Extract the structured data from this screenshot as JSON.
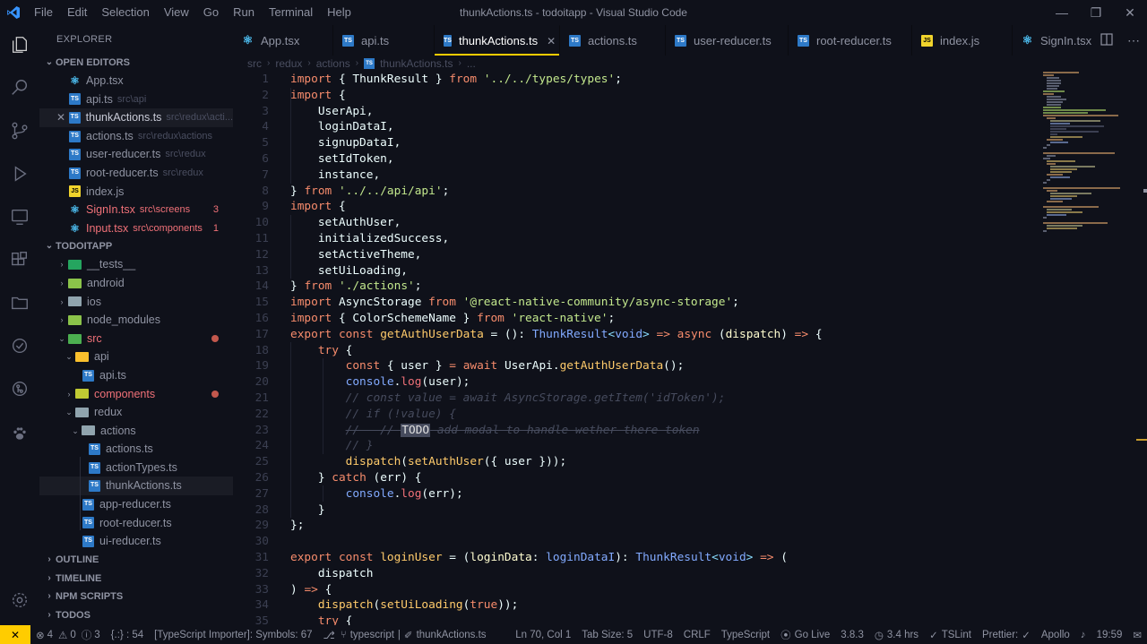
{
  "window": {
    "title": "thunkActions.ts - todoitapp - Visual Studio Code",
    "menu": [
      "File",
      "Edit",
      "Selection",
      "View",
      "Go",
      "Run",
      "Terminal",
      "Help"
    ]
  },
  "colors": {
    "accent": "#ffcc00",
    "background": "#0f111a",
    "error": "#f07178"
  },
  "sidebar": {
    "title": "EXPLORER",
    "open_editors_label": "OPEN EDITORS",
    "open_editors": [
      {
        "name": "App.tsx",
        "path": "",
        "icon": "react",
        "extra": ""
      },
      {
        "name": "api.ts",
        "path": "src\\api",
        "icon": "ts",
        "extra": ""
      },
      {
        "name": "thunkActions.ts",
        "path": "src\\redux\\acti...",
        "icon": "ts",
        "extra": ""
      },
      {
        "name": "actions.ts",
        "path": "src\\redux\\actions",
        "icon": "ts",
        "extra": ""
      },
      {
        "name": "user-reducer.ts",
        "path": "src\\redux",
        "icon": "ts",
        "extra": ""
      },
      {
        "name": "root-reducer.ts",
        "path": "src\\redux",
        "icon": "ts",
        "extra": ""
      },
      {
        "name": "index.js",
        "path": "",
        "icon": "js",
        "extra": ""
      },
      {
        "name": "SignIn.tsx",
        "path": "src\\screens",
        "icon": "react",
        "extra": "3"
      },
      {
        "name": "Input.tsx",
        "path": "src\\components",
        "icon": "react",
        "extra": "1"
      }
    ],
    "project_label": "TODOITAPP",
    "tree": [
      {
        "name": "__tests__",
        "depth": 1
      },
      {
        "name": "android",
        "depth": 1
      },
      {
        "name": "ios",
        "depth": 1
      },
      {
        "name": "node_modules",
        "depth": 1
      },
      {
        "name": "src",
        "depth": 1
      },
      {
        "name": "api",
        "depth": 2
      },
      {
        "name": "api.ts",
        "depth": 3
      },
      {
        "name": "components",
        "depth": 2
      },
      {
        "name": "redux",
        "depth": 2
      },
      {
        "name": "actions",
        "depth": 3
      },
      {
        "name": "actions.ts",
        "depth": 4
      },
      {
        "name": "actionTypes.ts",
        "depth": 4
      },
      {
        "name": "thunkActions.ts",
        "depth": 4
      },
      {
        "name": "app-reducer.ts",
        "depth": 3
      },
      {
        "name": "root-reducer.ts",
        "depth": 3
      },
      {
        "name": "ui-reducer.ts",
        "depth": 3
      }
    ],
    "bottom_sections": [
      "OUTLINE",
      "TIMELINE",
      "NPM SCRIPTS",
      "TODOS"
    ]
  },
  "tabs": [
    {
      "label": "App.tsx",
      "icon": "react"
    },
    {
      "label": "api.ts",
      "icon": "ts"
    },
    {
      "label": "thunkActions.ts",
      "icon": "ts",
      "active": true
    },
    {
      "label": "actions.ts",
      "icon": "ts"
    },
    {
      "label": "user-reducer.ts",
      "icon": "ts"
    },
    {
      "label": "root-reducer.ts",
      "icon": "ts"
    },
    {
      "label": "index.js",
      "icon": "js"
    },
    {
      "label": "SignIn.tsx",
      "icon": "react"
    }
  ],
  "breadcrumb": [
    "src",
    "redux",
    "actions",
    "thunkActions.ts",
    "..."
  ],
  "editor": {
    "lines": [
      "import { ThunkResult } from '../../types/types';",
      "import {",
      "    UserApi,",
      "    loginDataI,",
      "    signupDataI,",
      "    setIdToken,",
      "    instance,",
      "} from '../../api/api';",
      "import {",
      "    setAuthUser,",
      "    initializedSuccess,",
      "    setActiveTheme,",
      "    setUiLoading,",
      "} from './actions';",
      "import AsyncStorage from '@react-native-community/async-storage';",
      "import { ColorSchemeName } from 'react-native';",
      "export const getAuthUserData = (): ThunkResult<void> => async (dispatch) => {",
      "    try {",
      "        const { user } = await UserApi.getAuthUserData();",
      "        console.log(user);",
      "        // const value = await AsyncStorage.getItem('idToken');",
      "        // if (!value) {",
      "        //   // TODO add modal to handle wether there token",
      "        // }",
      "        dispatch(setAuthUser({ user }));",
      "    } catch (err) {",
      "        console.log(err);",
      "    }",
      "};",
      "",
      "export const loginUser = (loginData: loginDataI): ThunkResult<void> => (",
      "    dispatch",
      ") => {",
      "    dispatch(setUiLoading(true));",
      "    try {"
    ]
  },
  "status": {
    "errors": "4",
    "warnings": "0",
    "info": "3",
    "cursor_ctx": "{.:} : 54",
    "importer": "[TypeScript Importer]: Symbols: 67",
    "lang_ctx": "typescript",
    "file_ctx": "thunkActions.ts",
    "position": "Ln 70, Col 1",
    "tab_size": "Tab Size: 5",
    "encoding": "UTF-8",
    "eol": "CRLF",
    "language": "TypeScript",
    "go_live": "Go Live",
    "ts_version": "3.8.3",
    "time_tracked": "3.4 hrs",
    "tslint": "TSLint",
    "prettier": "Prettier:",
    "apollo": "Apollo",
    "clock": "19:59"
  },
  "icons": {
    "activity": [
      "files-icon",
      "search-icon",
      "source-control-icon",
      "run-debug-icon",
      "remote-explorer-icon",
      "extensions-icon",
      "folder-icon",
      "test-icon",
      "git-graph-icon",
      "paw-icon",
      "settings-gear-icon"
    ]
  }
}
